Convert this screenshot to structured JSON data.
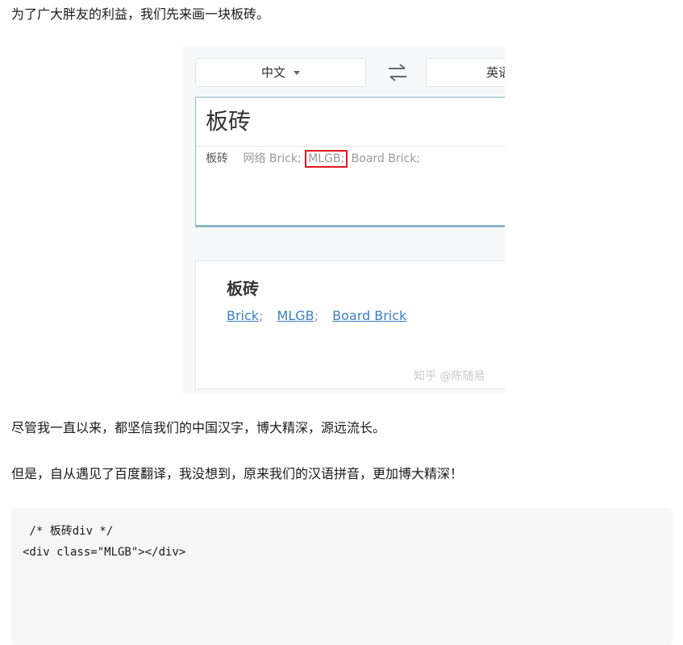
{
  "article": {
    "intro": "为了广大胖友的利益，我们先来画一块板砖。",
    "para2": "尽管我一直以来，都坚信我们的中国汉字，博大精深，源远流长。",
    "para3": "但是，自从遇见了百度翻译，我没想到，原来我们的汉语拼音，更加博大精深！"
  },
  "translator": {
    "source_lang": "中文",
    "target_lang": "英语",
    "swap_icon": "swap-arrows-icon",
    "input_text": "板砖",
    "suggestion_key": "板砖",
    "suggestion_prefix": "网络 Brick;",
    "suggestion_highlight": "MLGB;",
    "suggestion_suffix": "Board Brick;",
    "highlight_color": "#e0181e",
    "result_word": "板砖",
    "result_links": [
      {
        "label": "Brick",
        "sep": ";"
      },
      {
        "label": "MLGB",
        "sep": ";"
      },
      {
        "label": "Board Brick",
        "sep": ""
      }
    ],
    "watermark": "知乎 @陈随易"
  },
  "code": {
    "line1": " /* 板砖div */",
    "line2": "<div class=\"MLGB\"></div>"
  }
}
